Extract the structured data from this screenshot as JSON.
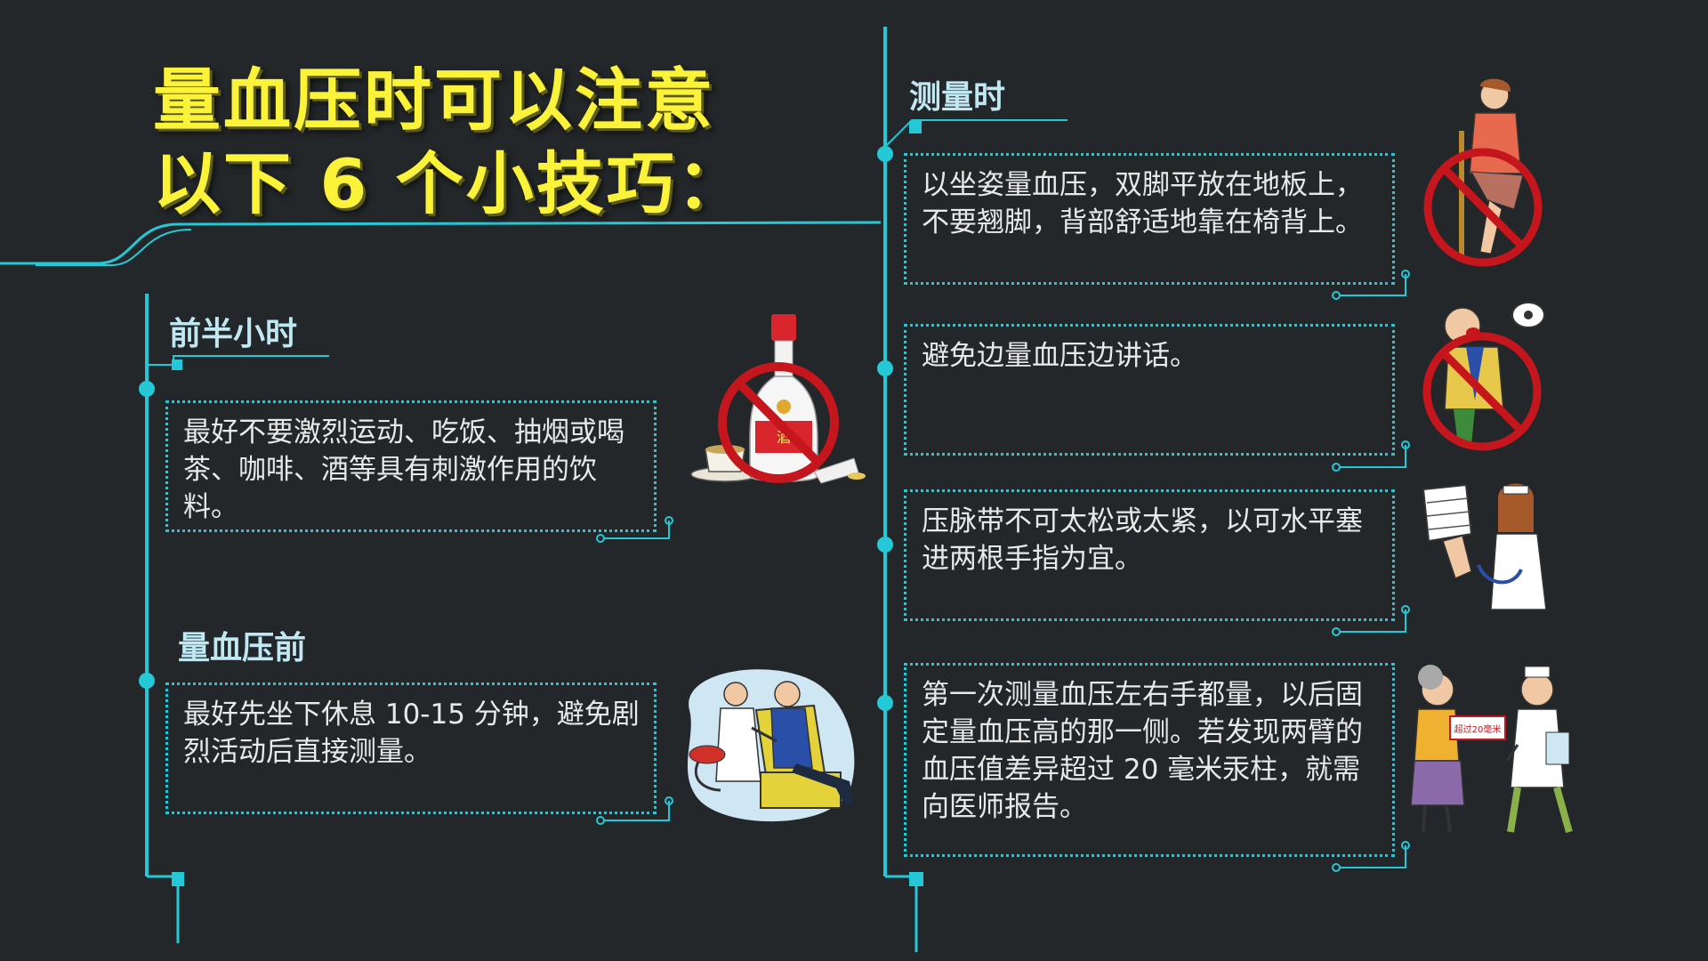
{
  "title": {
    "line1": "量血压时可以注意",
    "line2": "以下 6 个小技巧："
  },
  "sections": {
    "half_hour_before": "前半小时",
    "before_measuring": "量血压前",
    "while_measuring": "测量时"
  },
  "tips": {
    "no_stimulants": "最好不要激烈运动、吃饭、抽烟或喝茶、咖啡、酒等具有刺激作用的饮料。",
    "rest_first": "最好先坐下休息 10-15 分钟，避免剧烈活动后直接测量。",
    "sitting_posture": "以坐姿量血压，双脚平放在地板上，不要翘脚，背部舒适地靠在椅背上。",
    "no_talking": "避免边量血压边讲话。",
    "cuff_fit": "压脉带不可太松或太紧，以可水平塞进两根手指为宜。",
    "both_arms": "第一次测量血压左右手都量，以后固定量血压高的那一侧。若发现两臂的血压值差异超过 20 毫米汞柱，就需向医师报告。"
  },
  "illustrations": {
    "bottle_label": "酒",
    "report_card_text": "超过20毫米"
  },
  "colors": {
    "background": "#24272a",
    "accent_cyan": "#25c8d6",
    "title_yellow": "#fbf23a",
    "label_color": "#bfe8f2",
    "prohibit_red": "#c4161c"
  }
}
